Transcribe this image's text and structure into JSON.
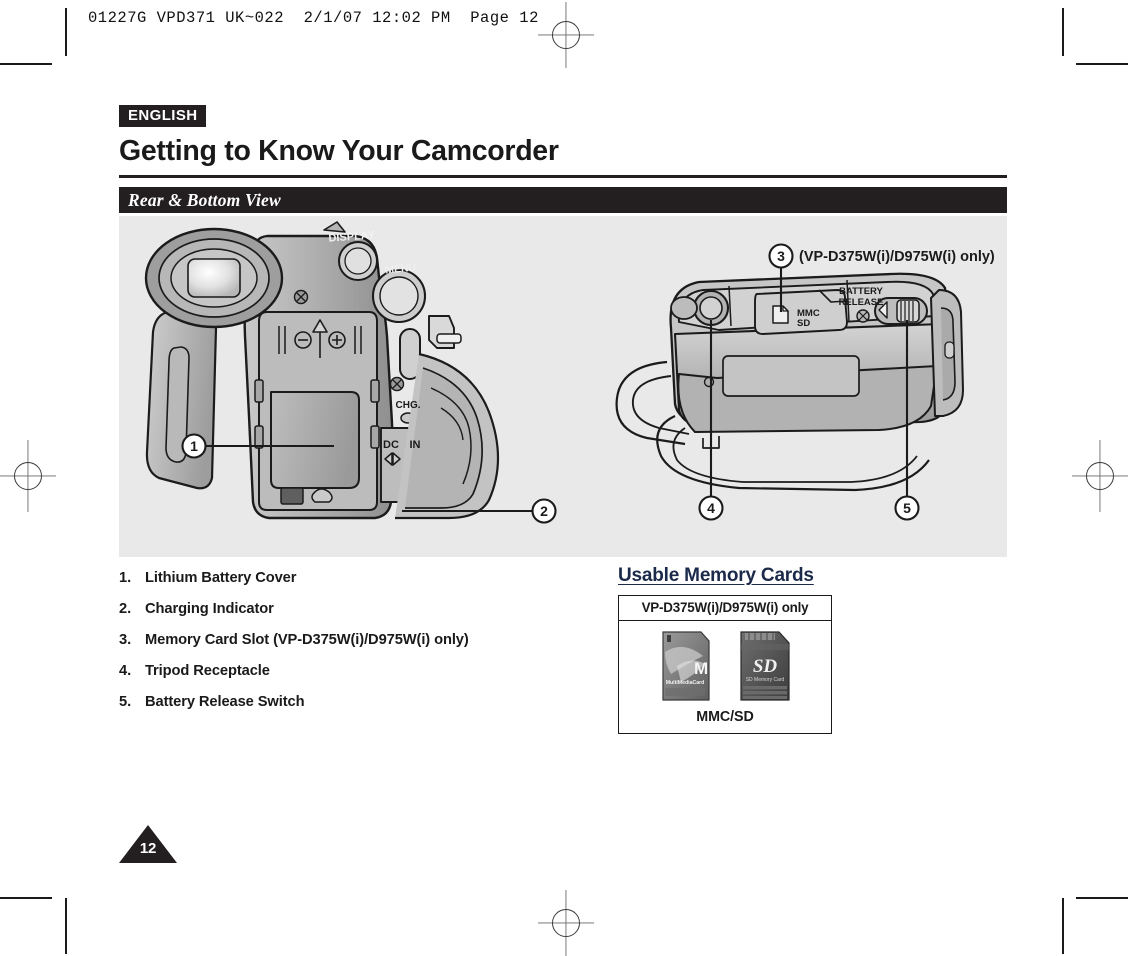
{
  "prepress": {
    "header_line": "01227G VPD371 UK~022  2/1/07 12:02 PM  Page 12"
  },
  "header": {
    "language_badge": "ENGLISH",
    "title": "Getting to Know Your Camcorder",
    "section_title": "Rear & Bottom View"
  },
  "illustration": {
    "rear_view": {
      "labels": {
        "display": "DISPLAY",
        "menu": "MENU",
        "charge": "CHG.",
        "dc_in_dc": "DC",
        "dc_in_in": "IN"
      }
    },
    "bottom_view": {
      "labels": {
        "card_slot_line1": "MMC",
        "card_slot_line2": "SD",
        "battery_release_line1": "BATTERY",
        "battery_release_line2": "RELEASE"
      }
    },
    "callouts": [
      {
        "id": "1",
        "glyph": "1"
      },
      {
        "id": "2",
        "glyph": "2"
      },
      {
        "id": "3",
        "glyph": "3"
      },
      {
        "id": "4",
        "glyph": "4"
      },
      {
        "id": "5",
        "glyph": "5"
      }
    ],
    "callout3_note": "(VP-D375W(i)/D975W(i) only)"
  },
  "parts_list": [
    {
      "number": "1.",
      "label": "Lithium Battery Cover"
    },
    {
      "number": "2.",
      "label": "Charging Indicator"
    },
    {
      "number": "3.",
      "label": "Memory Card Slot (VP-D375W(i)/D975W(i) only)"
    },
    {
      "number": "4.",
      "label": "Tripod Receptacle"
    },
    {
      "number": "5.",
      "label": "Battery Release Switch"
    }
  ],
  "memory_cards": {
    "heading": "Usable Memory Cards",
    "table_header": "VP-D375W(i)/D975W(i) only",
    "caption": "MMC/SD",
    "cards": [
      {
        "name": "MultiMediaCard",
        "logo": "M",
        "sub": "MultiMediaCard"
      },
      {
        "name": "SD Memory Card",
        "logo": "SD",
        "sub": "SD Memory Card"
      }
    ]
  },
  "footer": {
    "page_number": "12"
  },
  "colors": {
    "ink_dark": "#231f20",
    "panel_gray": "#e9e9e9",
    "heading_blue": "#1b2a4a",
    "body_ink": "#1a1a1a"
  }
}
